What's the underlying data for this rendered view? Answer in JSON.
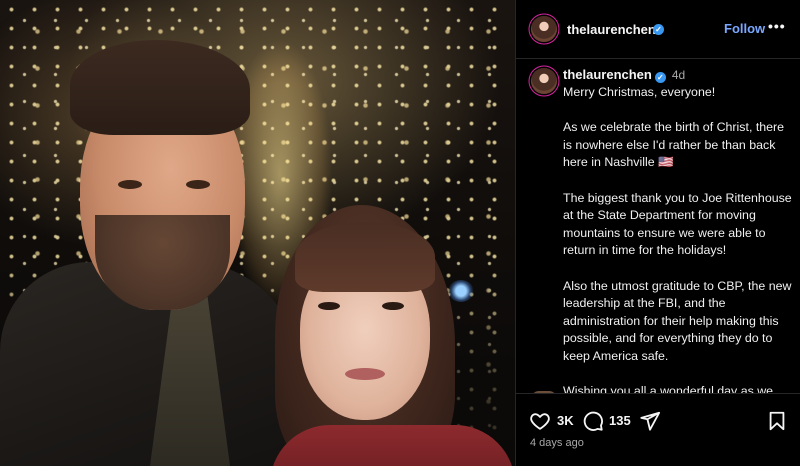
{
  "post": {
    "username": "thelaurenchen",
    "verified_mark": "✓",
    "follow_label": "Follow",
    "more_label": "•••",
    "age_short": "4d",
    "caption_paragraphs": [
      "Merry Christmas, everyone!",
      "As we celebrate the birth of Christ, there is nowhere else I'd rather be than back here in Nashville 🇺🇸",
      "The biggest thank you to Joe Rittenhouse at the State Department for moving mountains to ensure we were able to return in time for the holidays!",
      "Also the utmost gratitude to CBP, the new leadership at the FBI, and the administration for their help making this possible, and for everything they do to keep America safe.",
      "Wishing you all a wonderful day as we rejoice in our Savior's birth!"
    ],
    "closing_emoji": "✝",
    "likes": "3K",
    "comments": "135",
    "age_long": "4 days ago"
  },
  "icons": {
    "like": "heart-icon",
    "comment": "comment-bubble-icon",
    "share": "paper-plane-icon",
    "save": "bookmark-icon",
    "verified": "verified-badge-icon",
    "more": "more-options-icon"
  },
  "colors": {
    "background": "#000000",
    "follow": "#7aa7ff",
    "verified": "#3897f0",
    "muted_text": "#a8a8a8",
    "divider": "#262626"
  }
}
